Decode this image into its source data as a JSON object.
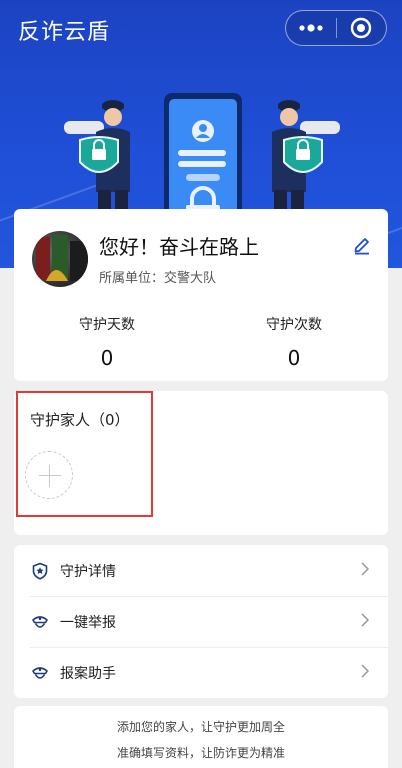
{
  "header": {
    "title": "反诈云盾",
    "more_icon": "more-dots-icon",
    "close_icon": "target-circle-icon"
  },
  "colors": {
    "hero_blue": "#1f4fd6",
    "highlight_red": "#e53935",
    "police_navy": "#1d2f5e",
    "shield_green": "#19a89a"
  },
  "profile": {
    "greeting": "您好！奋斗在路上",
    "unit": "所属单位：交警大队",
    "edit_icon": "pencil-icon",
    "stats": [
      {
        "label": "守护天数",
        "value": "0"
      },
      {
        "label": "守护次数",
        "value": "0"
      }
    ]
  },
  "family": {
    "title": "守护家人（0）",
    "add_icon": "plus-icon"
  },
  "menu": [
    {
      "label": "守护详情",
      "icon": "police-badge-icon"
    },
    {
      "label": "一键举报",
      "icon": "police-cap-icon"
    },
    {
      "label": "报案助手",
      "icon": "police-cap-icon"
    }
  ],
  "tips": [
    "添加您的家人，让守护更加周全",
    "准确填写资料，让防诈更为精准"
  ]
}
